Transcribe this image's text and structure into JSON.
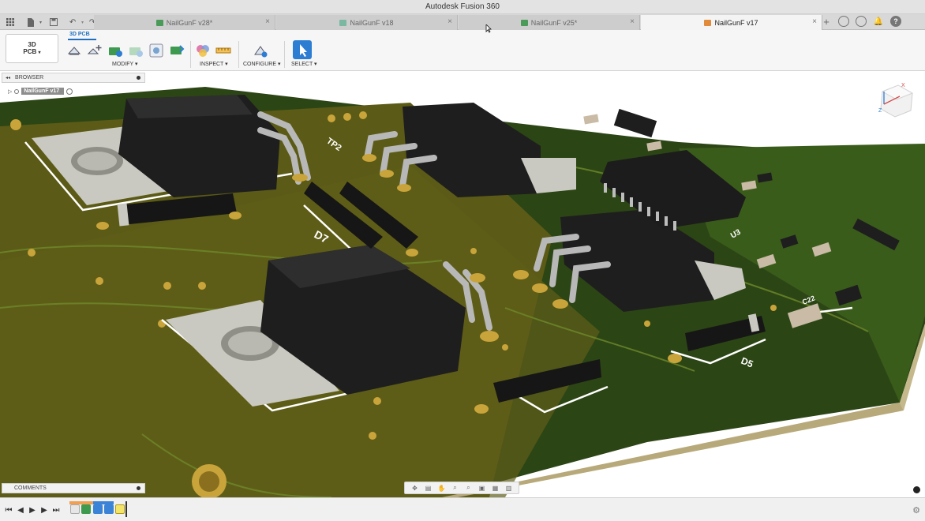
{
  "app": {
    "title": "Autodesk Fusion 360"
  },
  "tabs": [
    {
      "label": "NailGunF v28*",
      "active": false
    },
    {
      "label": "NailGunF v18",
      "active": false
    },
    {
      "label": "NailGunF v25*",
      "active": false
    },
    {
      "label": "NailGunF v17",
      "active": true
    }
  ],
  "toolbar": {
    "workspace_line1": "3D",
    "workspace_line2": "PCB",
    "workspace_tab": "3D PCB",
    "groups": {
      "modify": "MODIFY",
      "inspect": "INSPECT",
      "configure": "CONFIGURE",
      "select": "SELECT"
    }
  },
  "browser": {
    "title": "BROWSER",
    "root_item": "NailGunF v17"
  },
  "comments": {
    "title": "COMMENTS"
  },
  "pcb_labels": {
    "d7": "D7",
    "d5": "D5",
    "tp2": "TP2",
    "c22": "C22",
    "u3": "U3"
  },
  "icons": {
    "grid": "grid-icon",
    "file": "file-icon",
    "save": "save-icon",
    "undo": "undo-icon",
    "redo": "redo-icon",
    "add_tab": "plus-icon",
    "help": "help-icon"
  },
  "colors": {
    "accent": "#1f6fc0",
    "pcb_green": "#2f4a17",
    "pcb_olive": "#5a5a15",
    "silkscreen": "#ffffff",
    "pad_gold": "#c9a43a"
  }
}
